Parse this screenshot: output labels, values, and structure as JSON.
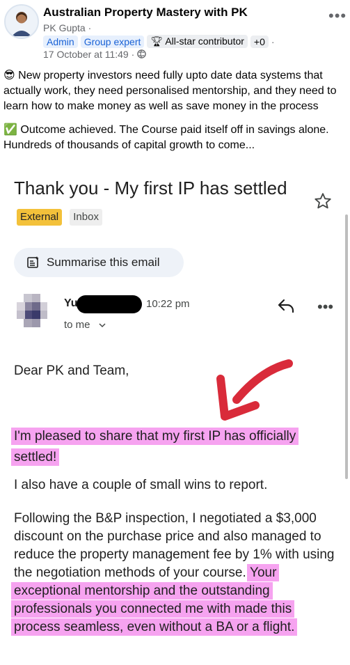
{
  "post": {
    "group_title": "Australian Property Mastery with PK",
    "author": "PK Gupta",
    "author_suffix": " ·",
    "badges": [
      "Admin",
      "Group expert",
      "All-star contributor",
      "+0"
    ],
    "date": "17 October at 11:49",
    "paragraph1_emoji": "😎",
    "paragraph1": "New property investors need fully upto date data systems that actually work, they need personalised mentorship, and they need to learn how to make money as well as save money in the process",
    "paragraph2_emoji": "✅",
    "paragraph2": "Outcome achieved. The Course paid itself off in savings alone. Hundreds of thousands of capital growth to come..."
  },
  "email": {
    "subject": "Thank you - My first IP has settled",
    "tag_external": "External",
    "tag_inbox": "Inbox",
    "summarise_label": "Summarise this email",
    "sender_name_visible": "Yu",
    "time": "10:22 pm",
    "to": "to me",
    "greeting": "Dear PK and Team,",
    "para1": "I'm pleased to share that my first IP has officially settled!",
    "para2": "I also have a couple of small wins to report.",
    "para3_plain": "Following the B&P inspection, I negotiated a $3,000 discount on the purchase price and also managed to reduce the property management fee by 1% with using the negotiation methods of your course. ",
    "para3_highlight": "Your exceptional mentorship and the outstanding professionals you connected me with made this process seamless, even without a BA or a flight."
  },
  "colors": {
    "highlight": "#f6a3f0",
    "arrow": "#d92b3a",
    "external_tag": "#f3c13a",
    "badge_blue": "#1b63d6"
  }
}
